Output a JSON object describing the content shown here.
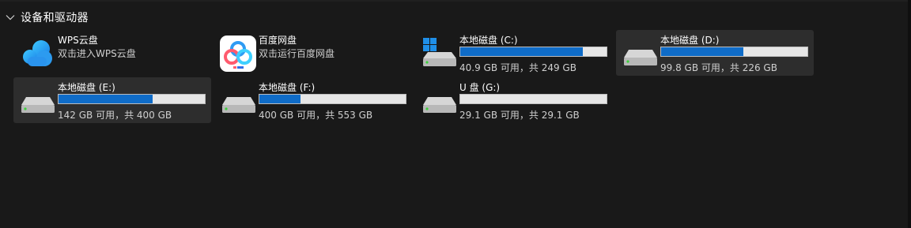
{
  "section": {
    "title": "设备和驱动器"
  },
  "apps": [
    {
      "name": "WPS云盘",
      "subtitle": "双击进入WPS云盘",
      "icon": "wps-cloud-icon"
    },
    {
      "name": "百度网盘",
      "subtitle": "双击运行百度网盘",
      "icon": "baidu-netdisk-icon"
    }
  ],
  "drives": [
    {
      "name": "本地磁盘 (C:)",
      "space": "40.9 GB 可用，共 249 GB",
      "used_fraction": 0.84,
      "icon": "windows-system-drive-icon"
    },
    {
      "name": "本地磁盘 (D:)",
      "space": "99.8 GB 可用，共 226 GB",
      "used_fraction": 0.56,
      "icon": "hard-drive-icon"
    },
    {
      "name": "本地磁盘 (E:)",
      "space": "142 GB 可用，共 400 GB",
      "used_fraction": 0.645,
      "icon": "hard-drive-icon"
    },
    {
      "name": "本地磁盘 (F:)",
      "space": "400 GB 可用，共 553 GB",
      "used_fraction": 0.28,
      "icon": "hard-drive-icon"
    },
    {
      "name": "U 盘 (G:)",
      "space": "29.1 GB 可用，共 29.1 GB",
      "used_fraction": 0.0,
      "icon": "usb-drive-icon"
    }
  ],
  "colors": {
    "background": "#191919",
    "selected_tile": "#2d2d2d",
    "bar_fill": "#0f6cc8",
    "bar_track": "#e6e6e6"
  }
}
